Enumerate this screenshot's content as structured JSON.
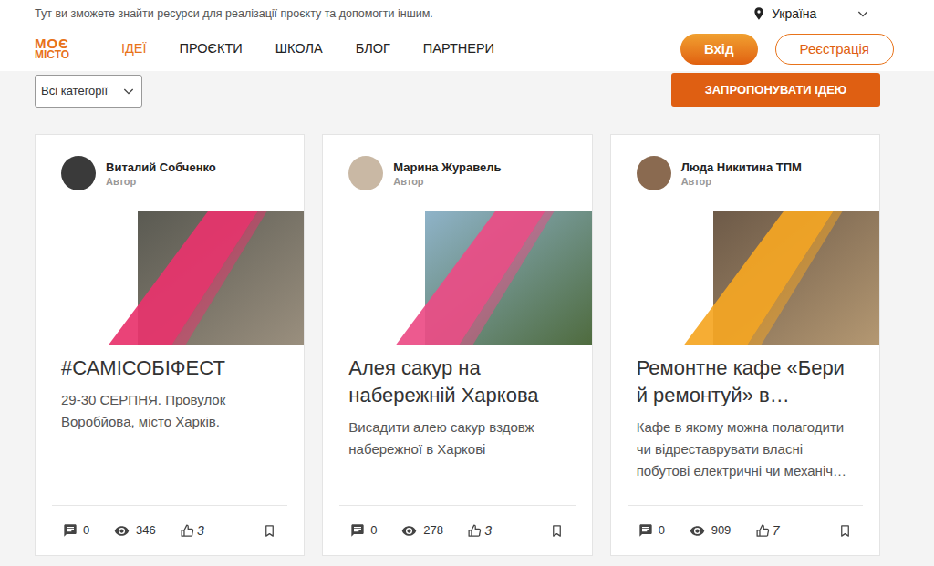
{
  "top_bar": {
    "tagline": "Тут ви зможете знайти ресурси для реалізації проєкту та допомогти іншим.",
    "region": "Україна"
  },
  "logo": {
    "line1": "МОЄ",
    "line2": "МІСТО"
  },
  "nav": [
    {
      "label": "ІДЕЇ",
      "selected": true
    },
    {
      "label": "ПРОЄКТИ",
      "selected": false
    },
    {
      "label": "ШКОЛА",
      "selected": false
    },
    {
      "label": "БЛОГ",
      "selected": false
    },
    {
      "label": "ПАРТНЕРИ",
      "selected": false
    }
  ],
  "auth": {
    "login": "Вхід",
    "register": "Реєстрація"
  },
  "filter": {
    "value": "Всі категорії"
  },
  "propose_button": "ЗАПРОПОНУВАТИ ІДЕЮ",
  "cards": [
    {
      "author": "Виталий Собченко",
      "role": "Автор",
      "title": "#САМІСОБІФЕСТ",
      "description": "29-30 СЕРПНЯ. Провулок Воробйова, місто Харків.",
      "comments": "0",
      "views": "346",
      "likes": "3",
      "color": "#e8336d"
    },
    {
      "author": "Марина Журавель",
      "role": "Автор",
      "title": "Алея сакур на набережній Харкова",
      "description": "Висадити алею сакур вздовж набережної в Харкові",
      "comments": "0",
      "views": "278",
      "likes": "3",
      "color": "#ec4c86"
    },
    {
      "author": "Люда Никитина ТПМ",
      "role": "Автор",
      "title": "Ремонтне кафе «Бери й ремонтуй» в…",
      "description": "Кафе в якому можна полагодити чи відреставрувати власні побутові електричні чи механіч…",
      "comments": "0",
      "views": "909",
      "likes": "7",
      "color": "#f5a623"
    }
  ]
}
